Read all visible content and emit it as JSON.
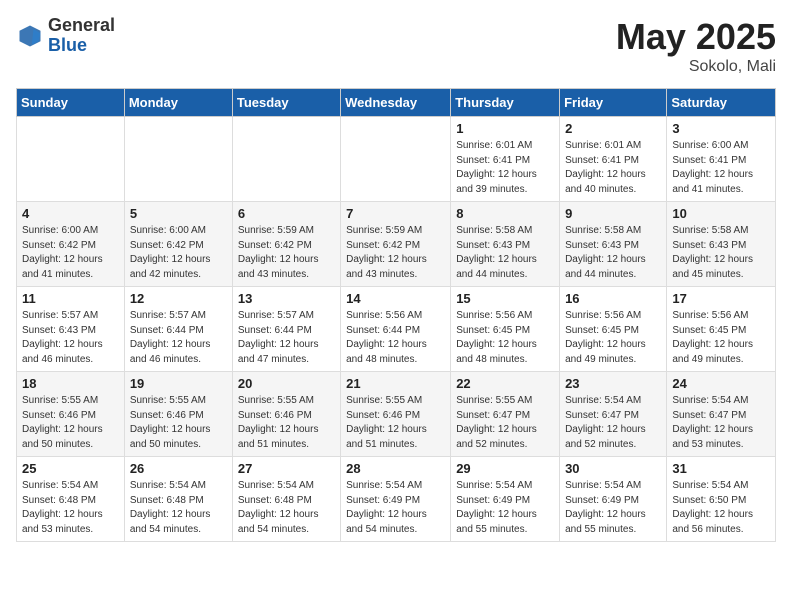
{
  "logo": {
    "general": "General",
    "blue": "Blue"
  },
  "title": "May 2025",
  "location": "Sokolo, Mali",
  "days_of_week": [
    "Sunday",
    "Monday",
    "Tuesday",
    "Wednesday",
    "Thursday",
    "Friday",
    "Saturday"
  ],
  "weeks": [
    [
      {
        "day": "",
        "content": ""
      },
      {
        "day": "",
        "content": ""
      },
      {
        "day": "",
        "content": ""
      },
      {
        "day": "",
        "content": ""
      },
      {
        "day": "1",
        "content": "Sunrise: 6:01 AM\nSunset: 6:41 PM\nDaylight: 12 hours and 39 minutes."
      },
      {
        "day": "2",
        "content": "Sunrise: 6:01 AM\nSunset: 6:41 PM\nDaylight: 12 hours and 40 minutes."
      },
      {
        "day": "3",
        "content": "Sunrise: 6:00 AM\nSunset: 6:41 PM\nDaylight: 12 hours and 41 minutes."
      }
    ],
    [
      {
        "day": "4",
        "content": "Sunrise: 6:00 AM\nSunset: 6:42 PM\nDaylight: 12 hours and 41 minutes."
      },
      {
        "day": "5",
        "content": "Sunrise: 6:00 AM\nSunset: 6:42 PM\nDaylight: 12 hours and 42 minutes."
      },
      {
        "day": "6",
        "content": "Sunrise: 5:59 AM\nSunset: 6:42 PM\nDaylight: 12 hours and 43 minutes."
      },
      {
        "day": "7",
        "content": "Sunrise: 5:59 AM\nSunset: 6:42 PM\nDaylight: 12 hours and 43 minutes."
      },
      {
        "day": "8",
        "content": "Sunrise: 5:58 AM\nSunset: 6:43 PM\nDaylight: 12 hours and 44 minutes."
      },
      {
        "day": "9",
        "content": "Sunrise: 5:58 AM\nSunset: 6:43 PM\nDaylight: 12 hours and 44 minutes."
      },
      {
        "day": "10",
        "content": "Sunrise: 5:58 AM\nSunset: 6:43 PM\nDaylight: 12 hours and 45 minutes."
      }
    ],
    [
      {
        "day": "11",
        "content": "Sunrise: 5:57 AM\nSunset: 6:43 PM\nDaylight: 12 hours and 46 minutes."
      },
      {
        "day": "12",
        "content": "Sunrise: 5:57 AM\nSunset: 6:44 PM\nDaylight: 12 hours and 46 minutes."
      },
      {
        "day": "13",
        "content": "Sunrise: 5:57 AM\nSunset: 6:44 PM\nDaylight: 12 hours and 47 minutes."
      },
      {
        "day": "14",
        "content": "Sunrise: 5:56 AM\nSunset: 6:44 PM\nDaylight: 12 hours and 48 minutes."
      },
      {
        "day": "15",
        "content": "Sunrise: 5:56 AM\nSunset: 6:45 PM\nDaylight: 12 hours and 48 minutes."
      },
      {
        "day": "16",
        "content": "Sunrise: 5:56 AM\nSunset: 6:45 PM\nDaylight: 12 hours and 49 minutes."
      },
      {
        "day": "17",
        "content": "Sunrise: 5:56 AM\nSunset: 6:45 PM\nDaylight: 12 hours and 49 minutes."
      }
    ],
    [
      {
        "day": "18",
        "content": "Sunrise: 5:55 AM\nSunset: 6:46 PM\nDaylight: 12 hours and 50 minutes."
      },
      {
        "day": "19",
        "content": "Sunrise: 5:55 AM\nSunset: 6:46 PM\nDaylight: 12 hours and 50 minutes."
      },
      {
        "day": "20",
        "content": "Sunrise: 5:55 AM\nSunset: 6:46 PM\nDaylight: 12 hours and 51 minutes."
      },
      {
        "day": "21",
        "content": "Sunrise: 5:55 AM\nSunset: 6:46 PM\nDaylight: 12 hours and 51 minutes."
      },
      {
        "day": "22",
        "content": "Sunrise: 5:55 AM\nSunset: 6:47 PM\nDaylight: 12 hours and 52 minutes."
      },
      {
        "day": "23",
        "content": "Sunrise: 5:54 AM\nSunset: 6:47 PM\nDaylight: 12 hours and 52 minutes."
      },
      {
        "day": "24",
        "content": "Sunrise: 5:54 AM\nSunset: 6:47 PM\nDaylight: 12 hours and 53 minutes."
      }
    ],
    [
      {
        "day": "25",
        "content": "Sunrise: 5:54 AM\nSunset: 6:48 PM\nDaylight: 12 hours and 53 minutes."
      },
      {
        "day": "26",
        "content": "Sunrise: 5:54 AM\nSunset: 6:48 PM\nDaylight: 12 hours and 54 minutes."
      },
      {
        "day": "27",
        "content": "Sunrise: 5:54 AM\nSunset: 6:48 PM\nDaylight: 12 hours and 54 minutes."
      },
      {
        "day": "28",
        "content": "Sunrise: 5:54 AM\nSunset: 6:49 PM\nDaylight: 12 hours and 54 minutes."
      },
      {
        "day": "29",
        "content": "Sunrise: 5:54 AM\nSunset: 6:49 PM\nDaylight: 12 hours and 55 minutes."
      },
      {
        "day": "30",
        "content": "Sunrise: 5:54 AM\nSunset: 6:49 PM\nDaylight: 12 hours and 55 minutes."
      },
      {
        "day": "31",
        "content": "Sunrise: 5:54 AM\nSunset: 6:50 PM\nDaylight: 12 hours and 56 minutes."
      }
    ]
  ]
}
